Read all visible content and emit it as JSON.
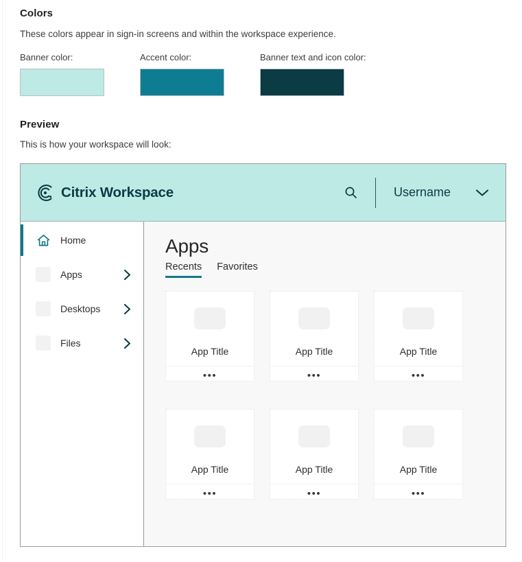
{
  "colors_section": {
    "title": "Colors",
    "description": "These colors appear in sign-in screens and within the workspace experience.",
    "swatches": [
      {
        "label": "Banner color:",
        "value": "#bdeae5",
        "name": "banner-color"
      },
      {
        "label": "Accent color:",
        "value": "#0e7d94",
        "name": "accent-color"
      },
      {
        "label": "Banner text and icon color:",
        "value": "#0b3b44",
        "name": "banner-text-icon-color"
      }
    ]
  },
  "preview_section": {
    "title": "Preview",
    "description": "This is how your workspace will look:"
  },
  "workspace": {
    "banner": {
      "background": "#bdeae5",
      "foreground": "#0b3b44",
      "logo_text": "Citrix Workspace",
      "logo_icon": "citrix-logo-icon",
      "search_icon": "search-icon",
      "username": "Username",
      "chevron_icon": "chevron-down-icon"
    },
    "sidebar": {
      "items": [
        {
          "label": "Home",
          "icon": "home-icon",
          "active": true,
          "chevron": false
        },
        {
          "label": "Apps",
          "icon": "placeholder-icon",
          "active": false,
          "chevron": true
        },
        {
          "label": "Desktops",
          "icon": "placeholder-icon",
          "active": false,
          "chevron": true
        },
        {
          "label": "Files",
          "icon": "placeholder-icon",
          "active": false,
          "chevron": true
        }
      ]
    },
    "content": {
      "heading": "Apps",
      "tabs": [
        {
          "label": "Recents",
          "active": true
        },
        {
          "label": "Favorites",
          "active": false
        }
      ],
      "cards": [
        {
          "title": "App Title",
          "more": "•••"
        },
        {
          "title": "App Title",
          "more": "•••"
        },
        {
          "title": "App Title",
          "more": "•••"
        },
        {
          "title": "App Title",
          "more": "•••"
        },
        {
          "title": "App Title",
          "more": "•••"
        },
        {
          "title": "App Title",
          "more": "•••"
        }
      ]
    }
  },
  "accent": "#14778a"
}
